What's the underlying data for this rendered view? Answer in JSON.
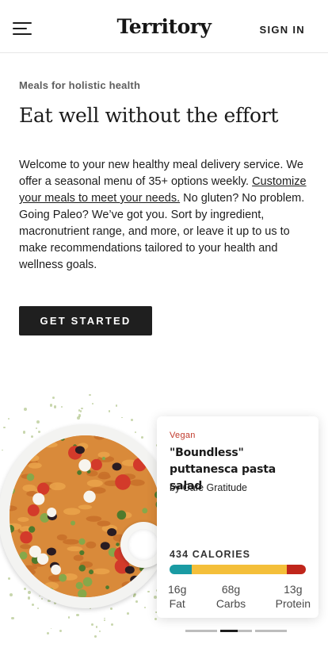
{
  "header": {
    "brand": "Territory",
    "signin_label": "SIGN IN"
  },
  "hero": {
    "eyebrow": "Meals for holistic health",
    "headline": "Eat well without the effort",
    "intro_before": "Welcome to your new healthy meal delivery service. We offer a seasonal menu of 35+ options weekly. ",
    "intro_link": "Customize your meals to meet your needs.",
    "intro_after": " No gluten? No problem. Going Paleo? We’ve got you. Sort by ingredient, macronutrient range, and more, or leave it up to us to make recommendations tailored to your health and wellness goals.",
    "cta_label": "GET STARTED"
  },
  "meal_card": {
    "tag": "Vegan",
    "title": "\"Boundless\" puttanesca pasta salad",
    "byline": "by Cafe Gratitude",
    "calories": "434 CALORIES",
    "macro_colors": {
      "fat": "#1a9ba3",
      "carbs": "#f4bf3a",
      "protein": "#c0261b"
    },
    "macro_fractions": {
      "fat": 0.16,
      "carbs": 0.7,
      "protein": 0.14
    },
    "macros": [
      {
        "amount": "16g",
        "label": "Fat"
      },
      {
        "amount": "68g",
        "label": "Carbs"
      },
      {
        "amount": "13g",
        "label": "Protein"
      }
    ]
  },
  "carousel": {
    "slides": 3,
    "active_index": 1
  }
}
